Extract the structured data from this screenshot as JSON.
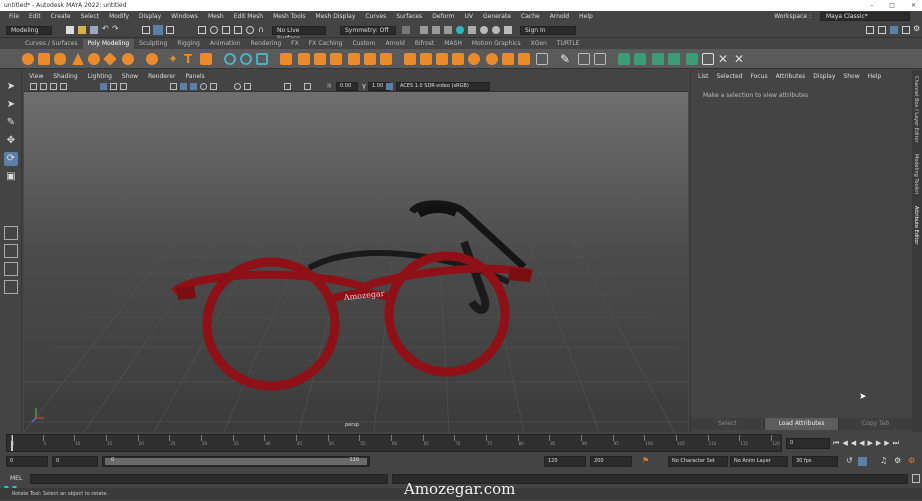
{
  "app": {
    "title": "untitled* - Autodesk MAYA 2022: untitled"
  },
  "menubar": {
    "items": [
      "File",
      "Edit",
      "Create",
      "Select",
      "Modify",
      "Display",
      "Windows",
      "Mesh",
      "Edit Mesh",
      "Mesh Tools",
      "Mesh Display",
      "Curves",
      "Surfaces",
      "Deform",
      "UV",
      "Generate",
      "Cache",
      "Arnold",
      "Help"
    ],
    "workspace_label": "Workspace :",
    "workspace_value": "Maya Classic*"
  },
  "statusline": {
    "menuset": "Modeling",
    "live_surface": "No Live Surface",
    "symmetry": "Symmetry: Off",
    "signin": "Sign In"
  },
  "shelf": {
    "tabs": [
      "Curves / Surfaces",
      "Poly Modeling",
      "Sculpting",
      "Rigging",
      "Animation",
      "Rendering",
      "FX",
      "FX Caching",
      "Custom",
      "Arnold",
      "Bifrost",
      "MASH",
      "Motion Graphics",
      "XGen",
      "TURTLE"
    ],
    "active_tab": "Poly Modeling"
  },
  "panel": {
    "menus": [
      "View",
      "Shading",
      "Lighting",
      "Show",
      "Renderer",
      "Panels"
    ],
    "exposure": "0.00",
    "gamma": "1.00",
    "colorspace": "ACES 1.0 SDR-video (sRGB)",
    "camera": "persp"
  },
  "model": {
    "brand_text": "Amozegar",
    "frame_color": "#8f1016"
  },
  "attribute_editor": {
    "menus": [
      "List",
      "Selected",
      "Focus",
      "Attributes",
      "Display",
      "Show",
      "Help"
    ],
    "message": "Make a selection to view attributes",
    "buttons": [
      "Select",
      "Load Attributes",
      "Copy Tab"
    ],
    "side_tabs": [
      "Channel Box / Layer Editor",
      "Modeling Toolkit",
      "Attribute Editor"
    ]
  },
  "timeslider": {
    "ticks": [
      "1",
      "5",
      "10",
      "15",
      "20",
      "25",
      "30",
      "35",
      "40",
      "45",
      "50",
      "55",
      "60",
      "65",
      "70",
      "75",
      "80",
      "85",
      "90",
      "95",
      "100",
      "105",
      "110",
      "115",
      "120"
    ],
    "current_frame": "0"
  },
  "range": {
    "start": "0",
    "playback_start": "0",
    "slider_start": "0",
    "slider_end": "120",
    "playback_end": "120",
    "end": "200",
    "character_set": "No Character Set",
    "anim_layer": "No Anim Layer",
    "fps": "30 fps"
  },
  "command_line": {
    "label": "MEL"
  },
  "help_line": {
    "text": "Rotate Tool: Select an object to rotate."
  },
  "watermark": {
    "text": "Amozegar.com"
  }
}
